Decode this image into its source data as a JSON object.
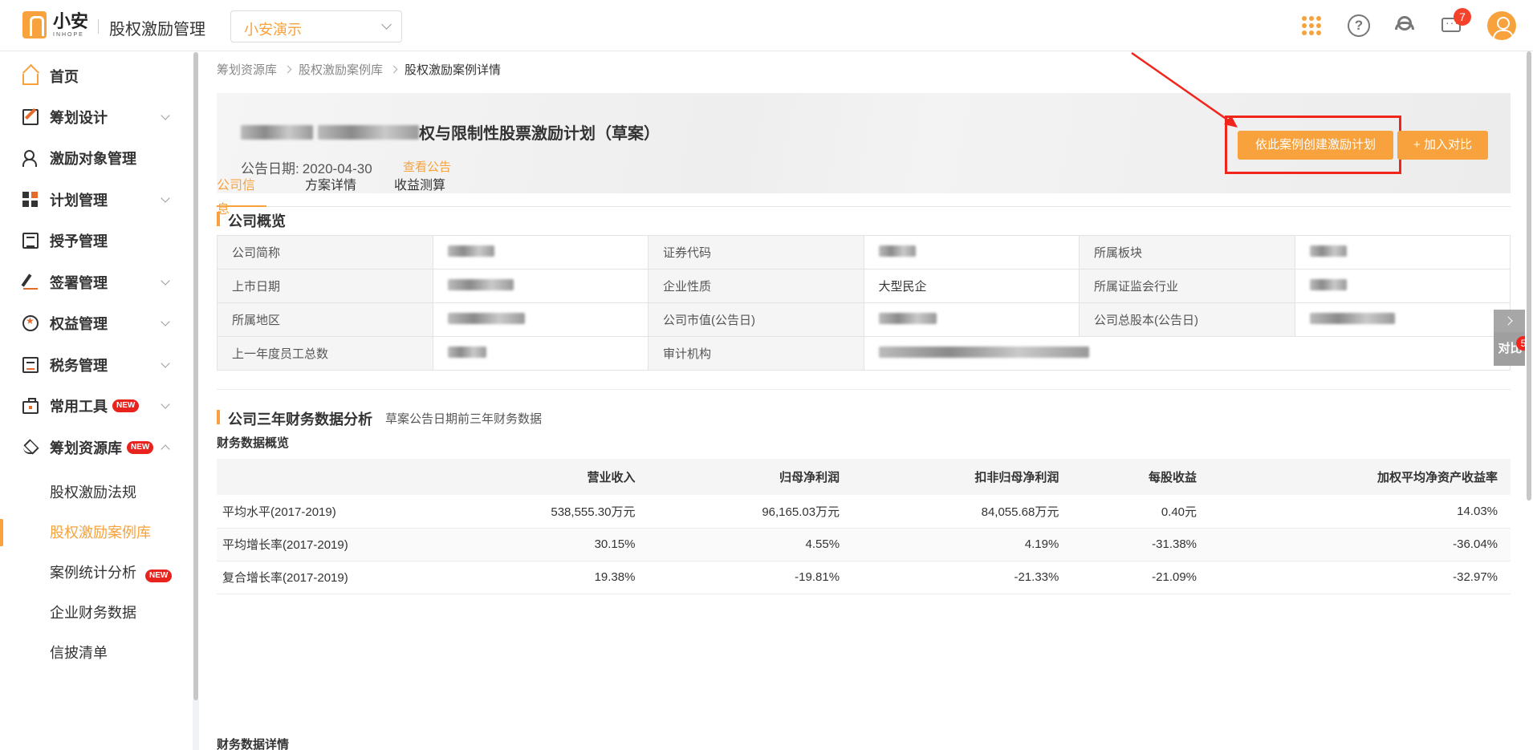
{
  "app": {
    "brand_cn": "小安",
    "brand_en": "INHOPE",
    "title": "股权激励管理",
    "org": "小安演示"
  },
  "header": {
    "message_count": "7"
  },
  "sidebar": {
    "items": [
      {
        "label": "首页"
      },
      {
        "label": "筹划设计"
      },
      {
        "label": "激励对象管理"
      },
      {
        "label": "计划管理"
      },
      {
        "label": "授予管理"
      },
      {
        "label": "签署管理"
      },
      {
        "label": "权益管理"
      },
      {
        "label": "税务管理"
      },
      {
        "label": "常用工具",
        "badge": "NEW"
      },
      {
        "label": "筹划资源库",
        "badge": "NEW"
      }
    ],
    "sub_items": [
      {
        "label": "股权激励法规"
      },
      {
        "label": "股权激励案例库"
      },
      {
        "label": "案例统计分析",
        "badge": "NEW"
      },
      {
        "label": "企业财务数据"
      },
      {
        "label": "信披清单"
      }
    ]
  },
  "breadcrumb": [
    "筹划资源库",
    "股权激励案例库",
    "股权激励案例详情"
  ],
  "case": {
    "title": "权与限制性股票激励计划（草案）",
    "date_label": "公告日期:",
    "date_value": "2020-04-30",
    "view_link": "查看公告",
    "create_button": "依此案例创建激励计划",
    "compare_button": "+ 加入对比"
  },
  "tabs": [
    "公司信息",
    "方案详情",
    "收益测算"
  ],
  "overview": {
    "title": "公司概览",
    "rows": [
      [
        "公司简称",
        "",
        "证券代码",
        "",
        "所属板块",
        ""
      ],
      [
        "上市日期",
        "",
        "企业性质",
        "大型民企",
        "所属证监会行业",
        ""
      ],
      [
        "所属地区",
        "",
        "公司市值(公告日)",
        "",
        "公司总股本(公告日)",
        ""
      ],
      [
        "上一年度员工总数",
        "",
        "审计机构",
        "",
        "",
        ""
      ]
    ]
  },
  "finance": {
    "title": "公司三年财务数据分析",
    "subtitle": "草案公告日期前三年财务数据",
    "overview_label": "财务数据概览",
    "details_label": "财务数据详情",
    "headers": [
      "",
      "营业收入",
      "归母净利润",
      "扣非归母净利润",
      "每股收益",
      "加权平均净资产收益率"
    ],
    "rows": [
      [
        "平均水平(2017-2019)",
        "538,555.30万元",
        "96,165.03万元",
        "84,055.68万元",
        "0.40元",
        "14.03%"
      ],
      [
        "平均增长率(2017-2019)",
        "30.15%",
        "4.55%",
        "4.19%",
        "-31.38%",
        "-36.04%"
      ],
      [
        "复合增长率(2017-2019)",
        "19.38%",
        "-19.81%",
        "-21.33%",
        "-21.09%",
        "-32.97%"
      ]
    ]
  },
  "compare_float": {
    "label": "对比",
    "count": "5"
  },
  "colors": {
    "accent": "#f7a23c",
    "highlight": "#f2251c",
    "badge": "#e8231d"
  }
}
